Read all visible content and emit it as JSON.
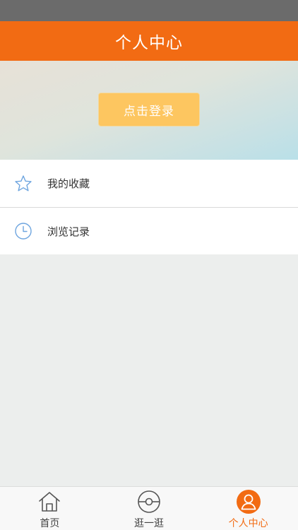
{
  "header": {
    "title": "个人中心"
  },
  "banner": {
    "login_label": "点击登录"
  },
  "menu": {
    "items": [
      {
        "label": "我的收藏",
        "icon": "star-icon"
      },
      {
        "label": "浏览记录",
        "icon": "clock-icon"
      }
    ]
  },
  "tabbar": {
    "tabs": [
      {
        "label": "首页",
        "icon": "home-icon",
        "active": false
      },
      {
        "label": "逛一逛",
        "icon": "explore-icon",
        "active": false
      },
      {
        "label": "个人中心",
        "icon": "user-icon",
        "active": true
      }
    ]
  },
  "colors": {
    "brand": "#f26b13",
    "login_button": "#fdc660",
    "icon_outline": "#6ea5df"
  }
}
